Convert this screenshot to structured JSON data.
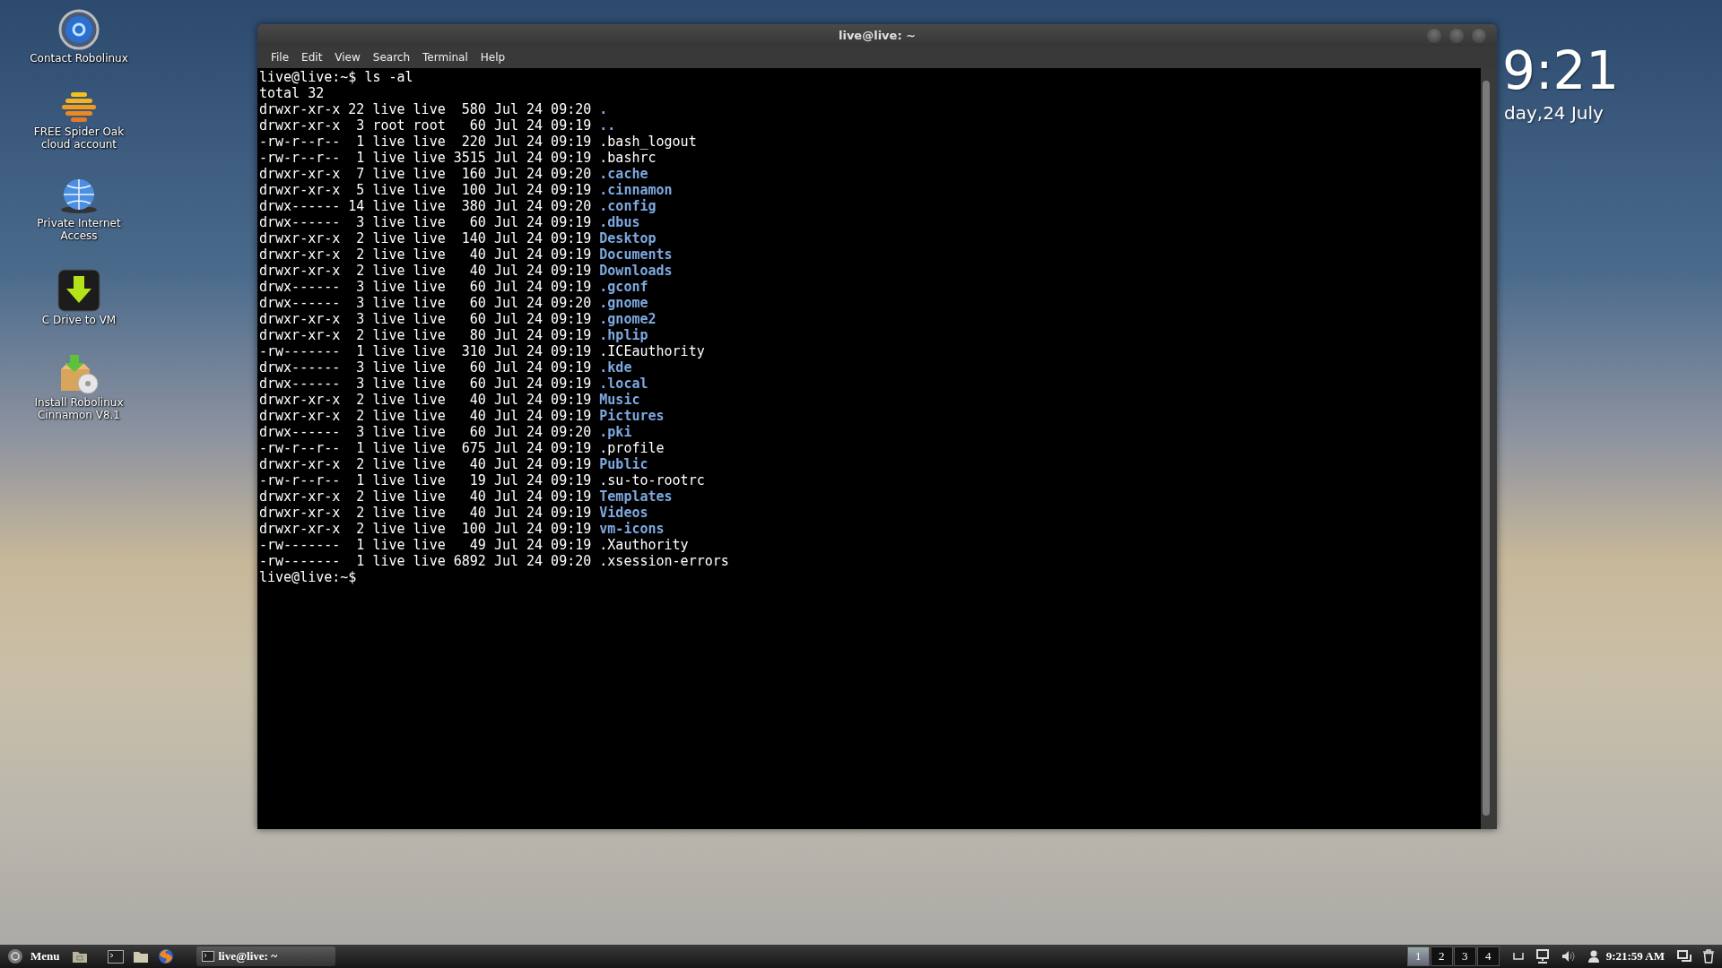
{
  "desktop_icons": [
    {
      "kind": "mail",
      "label": "Contact Robolinux"
    },
    {
      "kind": "stack",
      "label": "FREE Spider Oak cloud account"
    },
    {
      "kind": "globe",
      "label": "Private Internet Access"
    },
    {
      "kind": "download",
      "label": "C Drive to VM"
    },
    {
      "kind": "installer",
      "label": "Install Robolinux Cinnamon V8.1"
    }
  ],
  "window": {
    "title": "live@live: ~",
    "menu": [
      "File",
      "Edit",
      "View",
      "Search",
      "Terminal",
      "Help"
    ]
  },
  "terminal": {
    "lines": [
      {
        "kind": "text",
        "text": "live@live:~$ ls -al"
      },
      {
        "kind": "text",
        "text": "total 32"
      },
      {
        "kind": "entry",
        "info": "drwxr-xr-x 22 live live  580 Jul 24 09:20",
        "name": ".",
        "directory": true
      },
      {
        "kind": "entry",
        "info": "drwxr-xr-x  3 root root   60 Jul 24 09:19",
        "name": "..",
        "directory": true
      },
      {
        "kind": "entry",
        "info": "-rw-r--r--  1 live live  220 Jul 24 09:19",
        "name": ".bash_logout",
        "directory": false
      },
      {
        "kind": "entry",
        "info": "-rw-r--r--  1 live live 3515 Jul 24 09:19",
        "name": ".bashrc",
        "directory": false
      },
      {
        "kind": "entry",
        "info": "drwxr-xr-x  7 live live  160 Jul 24 09:20",
        "name": ".cache",
        "directory": true
      },
      {
        "kind": "entry",
        "info": "drwxr-xr-x  5 live live  100 Jul 24 09:19",
        "name": ".cinnamon",
        "directory": true
      },
      {
        "kind": "entry",
        "info": "drwx------ 14 live live  380 Jul 24 09:20",
        "name": ".config",
        "directory": true
      },
      {
        "kind": "entry",
        "info": "drwx------  3 live live   60 Jul 24 09:19",
        "name": ".dbus",
        "directory": true
      },
      {
        "kind": "entry",
        "info": "drwxr-xr-x  2 live live  140 Jul 24 09:19",
        "name": "Desktop",
        "directory": true
      },
      {
        "kind": "entry",
        "info": "drwxr-xr-x  2 live live   40 Jul 24 09:19",
        "name": "Documents",
        "directory": true
      },
      {
        "kind": "entry",
        "info": "drwxr-xr-x  2 live live   40 Jul 24 09:19",
        "name": "Downloads",
        "directory": true
      },
      {
        "kind": "entry",
        "info": "drwx------  3 live live   60 Jul 24 09:19",
        "name": ".gconf",
        "directory": true
      },
      {
        "kind": "entry",
        "info": "drwx------  3 live live   60 Jul 24 09:20",
        "name": ".gnome",
        "directory": true
      },
      {
        "kind": "entry",
        "info": "drwxr-xr-x  3 live live   60 Jul 24 09:19",
        "name": ".gnome2",
        "directory": true
      },
      {
        "kind": "entry",
        "info": "drwxr-xr-x  2 live live   80 Jul 24 09:19",
        "name": ".hplip",
        "directory": true
      },
      {
        "kind": "entry",
        "info": "-rw-------  1 live live  310 Jul 24 09:19",
        "name": ".ICEauthority",
        "directory": false
      },
      {
        "kind": "entry",
        "info": "drwx------  3 live live   60 Jul 24 09:19",
        "name": ".kde",
        "directory": true
      },
      {
        "kind": "entry",
        "info": "drwx------  3 live live   60 Jul 24 09:19",
        "name": ".local",
        "directory": true
      },
      {
        "kind": "entry",
        "info": "drwxr-xr-x  2 live live   40 Jul 24 09:19",
        "name": "Music",
        "directory": true
      },
      {
        "kind": "entry",
        "info": "drwxr-xr-x  2 live live   40 Jul 24 09:19",
        "name": "Pictures",
        "directory": true
      },
      {
        "kind": "entry",
        "info": "drwx------  3 live live   60 Jul 24 09:20",
        "name": ".pki",
        "directory": true
      },
      {
        "kind": "entry",
        "info": "-rw-r--r--  1 live live  675 Jul 24 09:19",
        "name": ".profile",
        "directory": false
      },
      {
        "kind": "entry",
        "info": "drwxr-xr-x  2 live live   40 Jul 24 09:19",
        "name": "Public",
        "directory": true
      },
      {
        "kind": "entry",
        "info": "-rw-r--r--  1 live live   19 Jul 24 09:19",
        "name": ".su-to-rootrc",
        "directory": false
      },
      {
        "kind": "entry",
        "info": "drwxr-xr-x  2 live live   40 Jul 24 09:19",
        "name": "Templates",
        "directory": true
      },
      {
        "kind": "entry",
        "info": "drwxr-xr-x  2 live live   40 Jul 24 09:19",
        "name": "Videos",
        "directory": true
      },
      {
        "kind": "entry",
        "info": "drwxr-xr-x  2 live live  100 Jul 24 09:19",
        "name": "vm-icons",
        "directory": true
      },
      {
        "kind": "entry",
        "info": "-rw-------  1 live live   49 Jul 24 09:19",
        "name": ".Xauthority",
        "directory": false
      },
      {
        "kind": "entry",
        "info": "-rw-------  1 live live 6892 Jul 24 09:20",
        "name": ".xsession-errors",
        "directory": false
      },
      {
        "kind": "text",
        "text": "live@live:~$"
      }
    ]
  },
  "clock": {
    "time": "9:21",
    "date": "day,24 July"
  },
  "taskbar": {
    "menu_label": "Menu",
    "launchers": [
      {
        "kind": "home-folder"
      },
      {
        "kind": "terminal"
      },
      {
        "kind": "folder"
      },
      {
        "kind": "browser"
      }
    ],
    "window_buttons": [
      {
        "label": "live@live: ~",
        "selected": false
      }
    ],
    "workspaces": [
      {
        "label": "1",
        "selected": true
      },
      {
        "label": "2",
        "selected": false
      },
      {
        "label": "3",
        "selected": false
      },
      {
        "label": "4",
        "selected": false
      }
    ],
    "time": "9:21:59 AM"
  }
}
